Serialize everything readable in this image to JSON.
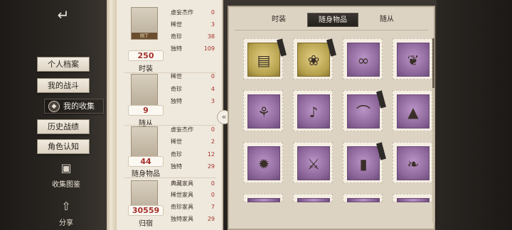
{
  "sidebar": {
    "exit_icon": "exit-door-icon",
    "nav": [
      {
        "label": "个人档案"
      },
      {
        "label": "我的战斗"
      },
      {
        "label": "我的收集",
        "active": true
      },
      {
        "label": "历史战绩"
      },
      {
        "label": "角色认知"
      }
    ],
    "tools": [
      {
        "label": "收集图鉴",
        "icon": "book-icon"
      },
      {
        "label": "分享",
        "icon": "share-icon"
      }
    ]
  },
  "stats": [
    {
      "count": "250",
      "name": "时装",
      "thumb_caption": "园丁",
      "rows": [
        {
          "k": "虚妄杰作",
          "v": "0"
        },
        {
          "k": "稀世",
          "v": "3"
        },
        {
          "k": "奇珍",
          "v": "38"
        },
        {
          "k": "独特",
          "v": "109"
        }
      ]
    },
    {
      "count": "9",
      "name": "随从",
      "rows": [
        {
          "k": "稀世",
          "v": "0"
        },
        {
          "k": "奇珍",
          "v": "4"
        },
        {
          "k": "独特",
          "v": "3"
        }
      ]
    },
    {
      "count": "44",
      "name": "随身物品",
      "rows": [
        {
          "k": "虚妄杰作",
          "v": "0"
        },
        {
          "k": "稀世",
          "v": "2"
        },
        {
          "k": "奇珍",
          "v": "12"
        },
        {
          "k": "独特",
          "v": "29"
        }
      ]
    },
    {
      "count": "30559",
      "name": "归宿",
      "rows": [
        {
          "k": "典藏家具",
          "v": "0"
        },
        {
          "k": "稀世家具",
          "v": "0"
        },
        {
          "k": "奇珍家具",
          "v": "7"
        },
        {
          "k": "独特家具",
          "v": "29"
        }
      ]
    }
  ],
  "tabs": [
    {
      "label": "时装"
    },
    {
      "label": "随身物品",
      "active": true
    },
    {
      "label": "随从"
    }
  ],
  "items": [
    {
      "icon": "red-book-icon",
      "rarity": "gold",
      "flag": true
    },
    {
      "icon": "golden-flower-icon",
      "rarity": "gold",
      "flag": true
    },
    {
      "icon": "silver-ribbon-icon",
      "rarity": "purple"
    },
    {
      "icon": "dark-feather-icon",
      "rarity": "purple"
    },
    {
      "icon": "antler-staff-icon",
      "rarity": "purple"
    },
    {
      "icon": "guitar-icon",
      "rarity": "purple"
    },
    {
      "icon": "white-scarf-icon",
      "rarity": "purple",
      "flag": true
    },
    {
      "icon": "bell-icon",
      "rarity": "purple"
    },
    {
      "icon": "spiked-mace-icon",
      "rarity": "purple"
    },
    {
      "icon": "blue-staff-icon",
      "rarity": "purple"
    },
    {
      "icon": "dark-blade-icon",
      "rarity": "purple",
      "flag": true
    },
    {
      "icon": "white-leaf-icon",
      "rarity": "purple"
    }
  ],
  "colors": {
    "accent_red": "#a5302a",
    "purple_card": "#8b6498",
    "gold_card": "#b6a14d"
  }
}
